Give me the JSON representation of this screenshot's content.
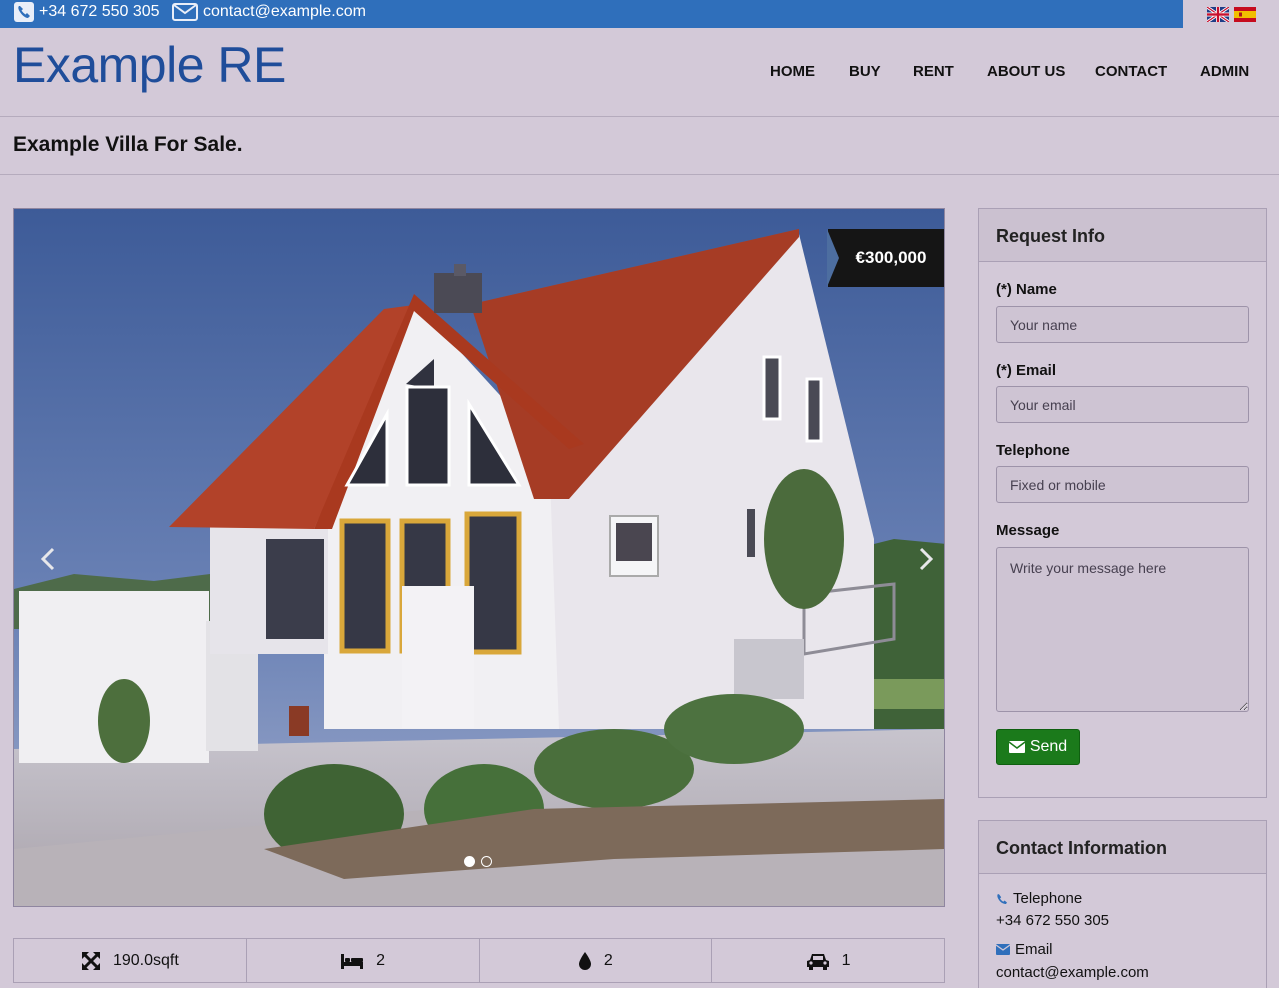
{
  "topbar": {
    "phone": "+34 672 550 305",
    "email": "contact@example.com",
    "languages": [
      "en",
      "es"
    ]
  },
  "header": {
    "logo": "Example RE",
    "nav": [
      "HOME",
      "BUY",
      "RENT",
      "ABOUT US",
      "CONTACT",
      "ADMIN"
    ]
  },
  "page": {
    "title": "Example Villa For Sale."
  },
  "listing": {
    "price": "€300,000",
    "slides_total": 2,
    "active_slide": 1,
    "features": {
      "area": "190.0sqft",
      "bedrooms": "2",
      "bathrooms": "2",
      "parking": "1"
    }
  },
  "request_form": {
    "heading": "Request Info",
    "name_label": "(*) Name",
    "name_placeholder": "Your name",
    "email_label": "(*) Email",
    "email_placeholder": "Your email",
    "telephone_label": "Telephone",
    "telephone_placeholder": "Fixed or mobile",
    "message_label": "Message",
    "message_placeholder": "Write your message here",
    "send_label": "Send"
  },
  "contact_info": {
    "heading": "Contact Information",
    "telephone_label": "Telephone",
    "telephone_value": "+34 672 550 305",
    "email_label": "Email",
    "email_value": "contact@example.com"
  },
  "colors": {
    "page_bg": "#d3c9d8",
    "topbar": "#2f6fbb",
    "logo": "#1f4d9a",
    "send_button": "#1b7a1b",
    "price_tag": "#151515"
  },
  "icons": [
    "phone-icon",
    "envelope-icon",
    "uk-flag-icon",
    "spain-flag-icon",
    "expand-arrows-icon",
    "bed-icon",
    "water-drop-icon",
    "car-icon",
    "chevron-left-icon",
    "chevron-right-icon"
  ]
}
